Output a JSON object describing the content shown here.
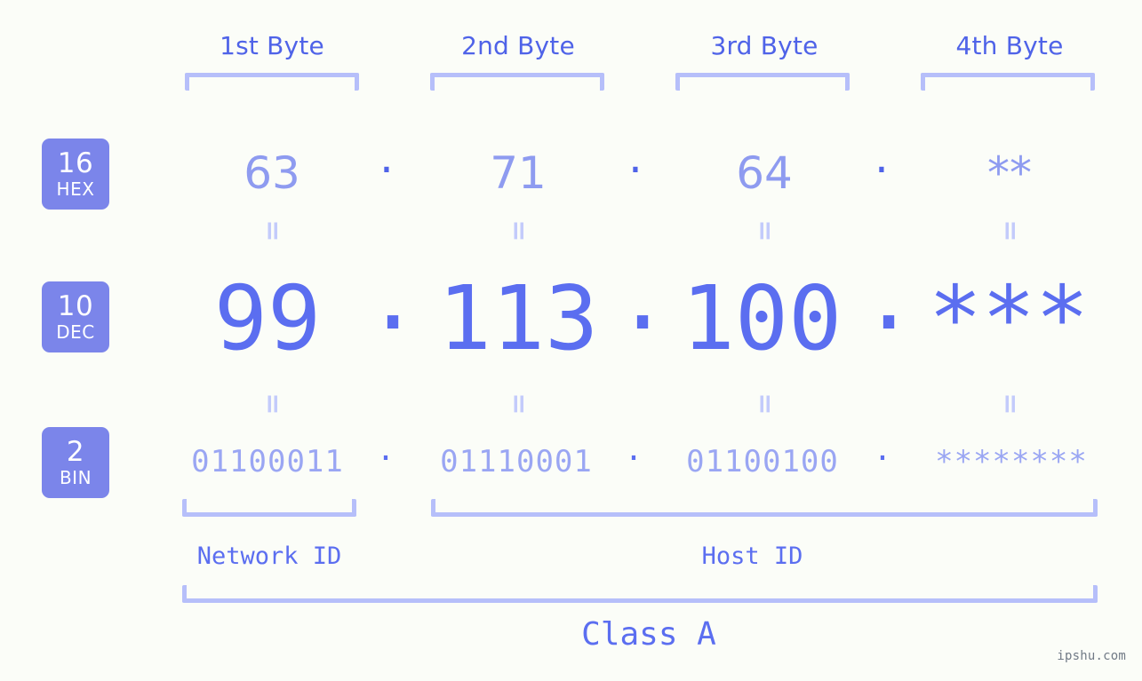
{
  "meta": {
    "background_color": "#fbfdf8",
    "accent_color": "#5b6ef0",
    "badge_color": "#7b85ea",
    "bracket_color": "#b6bffa",
    "watermark": "ipshu.com"
  },
  "byte_headers": [
    {
      "label": "1st Byte"
    },
    {
      "label": "2nd Byte"
    },
    {
      "label": "3rd Byte"
    },
    {
      "label": "4th Byte"
    }
  ],
  "rows": [
    {
      "badge_base": "16",
      "badge_name": "HEX",
      "values": [
        "63",
        "71",
        "64",
        "**"
      ],
      "separator": "."
    },
    {
      "badge_base": "10",
      "badge_name": "DEC",
      "values": [
        "99",
        "113",
        "100",
        "***"
      ],
      "separator": "."
    },
    {
      "badge_base": "2",
      "badge_name": "BIN",
      "values": [
        "01100011",
        "01110001",
        "01100100",
        "********"
      ],
      "separator": "."
    }
  ],
  "equals_symbol": "=",
  "sections": {
    "network_id": "Network ID",
    "host_id": "Host ID",
    "class": "Class A"
  }
}
